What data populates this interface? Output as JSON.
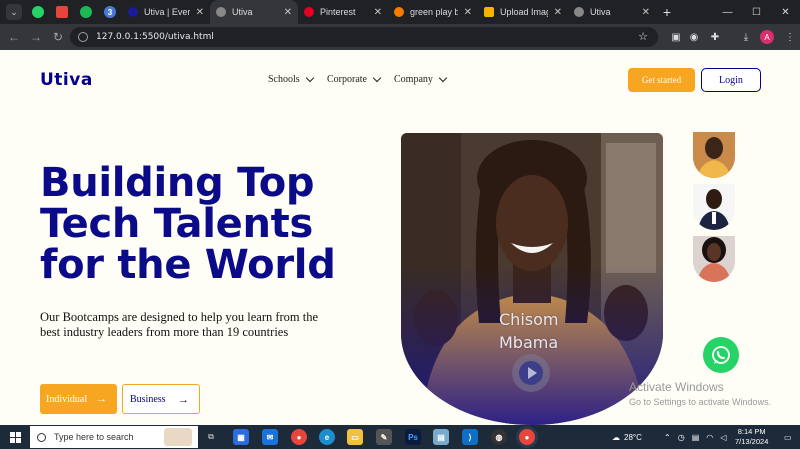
{
  "browser": {
    "tabs": [
      {
        "label": "Utiva | Everythi",
        "active": false
      },
      {
        "label": "Utiva",
        "active": true
      },
      {
        "label": "Pinterest",
        "active": false
      },
      {
        "label": "green play butt",
        "active": false
      },
      {
        "label": "Upload Image",
        "active": false
      },
      {
        "label": "Utiva",
        "active": false
      }
    ],
    "pinned_badge": "3",
    "url": "127.0.0.1:5500/utiva.html",
    "profile_initial": "A"
  },
  "site": {
    "logo": "Utiva",
    "nav": [
      "Schools",
      "Corporate",
      "Company"
    ],
    "get_started": "Get started",
    "login": "Login",
    "hero_lines": [
      "Building Top",
      "Tech Talents",
      "for the World"
    ],
    "hero_sub": "Our Bootcamps are designed to help you learn from the best industry leaders from more than 19 countries",
    "btn_individual": "Individual",
    "btn_business": "Business",
    "person_first": "Chisom",
    "person_last": "Mbama",
    "activate_title": "Activate Windows",
    "activate_sub": "Go to Settings to activate Windows."
  },
  "taskbar": {
    "search_placeholder": "Type here to search",
    "temperature": "28°C",
    "time": "8:14 PM",
    "date": "7/13/2024"
  },
  "colors": {
    "brand_blue": "#0b0b8a",
    "accent_orange": "#f7a622",
    "page_bg": "#fefdf6"
  }
}
